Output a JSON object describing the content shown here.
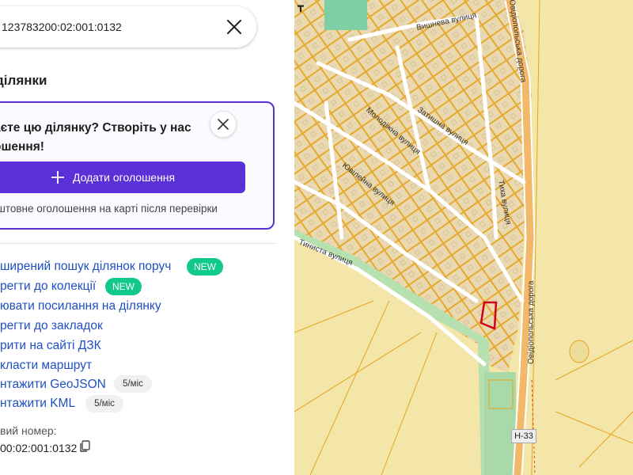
{
  "search": {
    "value": "123783200:02:001:0132"
  },
  "section_title": "ділянки",
  "promo": {
    "text": "аєте цю ділянку? Створіть у нас ошення!",
    "button_label": "Додати оголошення",
    "note": "штовне оголошення на карті після перевірки"
  },
  "actions": [
    {
      "label": "ширений пошук ділянок поруч",
      "badge": "NEW"
    },
    {
      "label": "регти до колекції",
      "badge": "NEW"
    },
    {
      "label": "ювати посилання на ділянку"
    },
    {
      "label": "регти до закладок"
    },
    {
      "label": "рити на сайті ДЗК"
    },
    {
      "label": "класти маршрут"
    },
    {
      "label": "нтажити GeoJSON",
      "quota": "5/міс"
    },
    {
      "label": "нтажити KML",
      "quota": "5/міс"
    }
  ],
  "cadastral": {
    "label": "вий номер:",
    "value": "00:02:001:0132"
  },
  "map": {
    "street_labels": [
      "Вишнева вулиця",
      "Затишна вулиця",
      "Молодіжна вулиця",
      "Ювілейна вулиця",
      "Тиха вулиця",
      "Тиниста вулиця",
      "Овідіопольська дорога",
      "Овідіопольська дорога"
    ],
    "road_shield": "Н-33",
    "colors": {
      "parcel_fill": "#ead9b0",
      "parcel_outline": "#e5a41e",
      "field": "#f4e6a8",
      "selected": "#d0021b"
    }
  },
  "colors": {
    "accent": "#5b30d6",
    "link": "#1f4fc4",
    "new_badge": "#11c98b"
  }
}
